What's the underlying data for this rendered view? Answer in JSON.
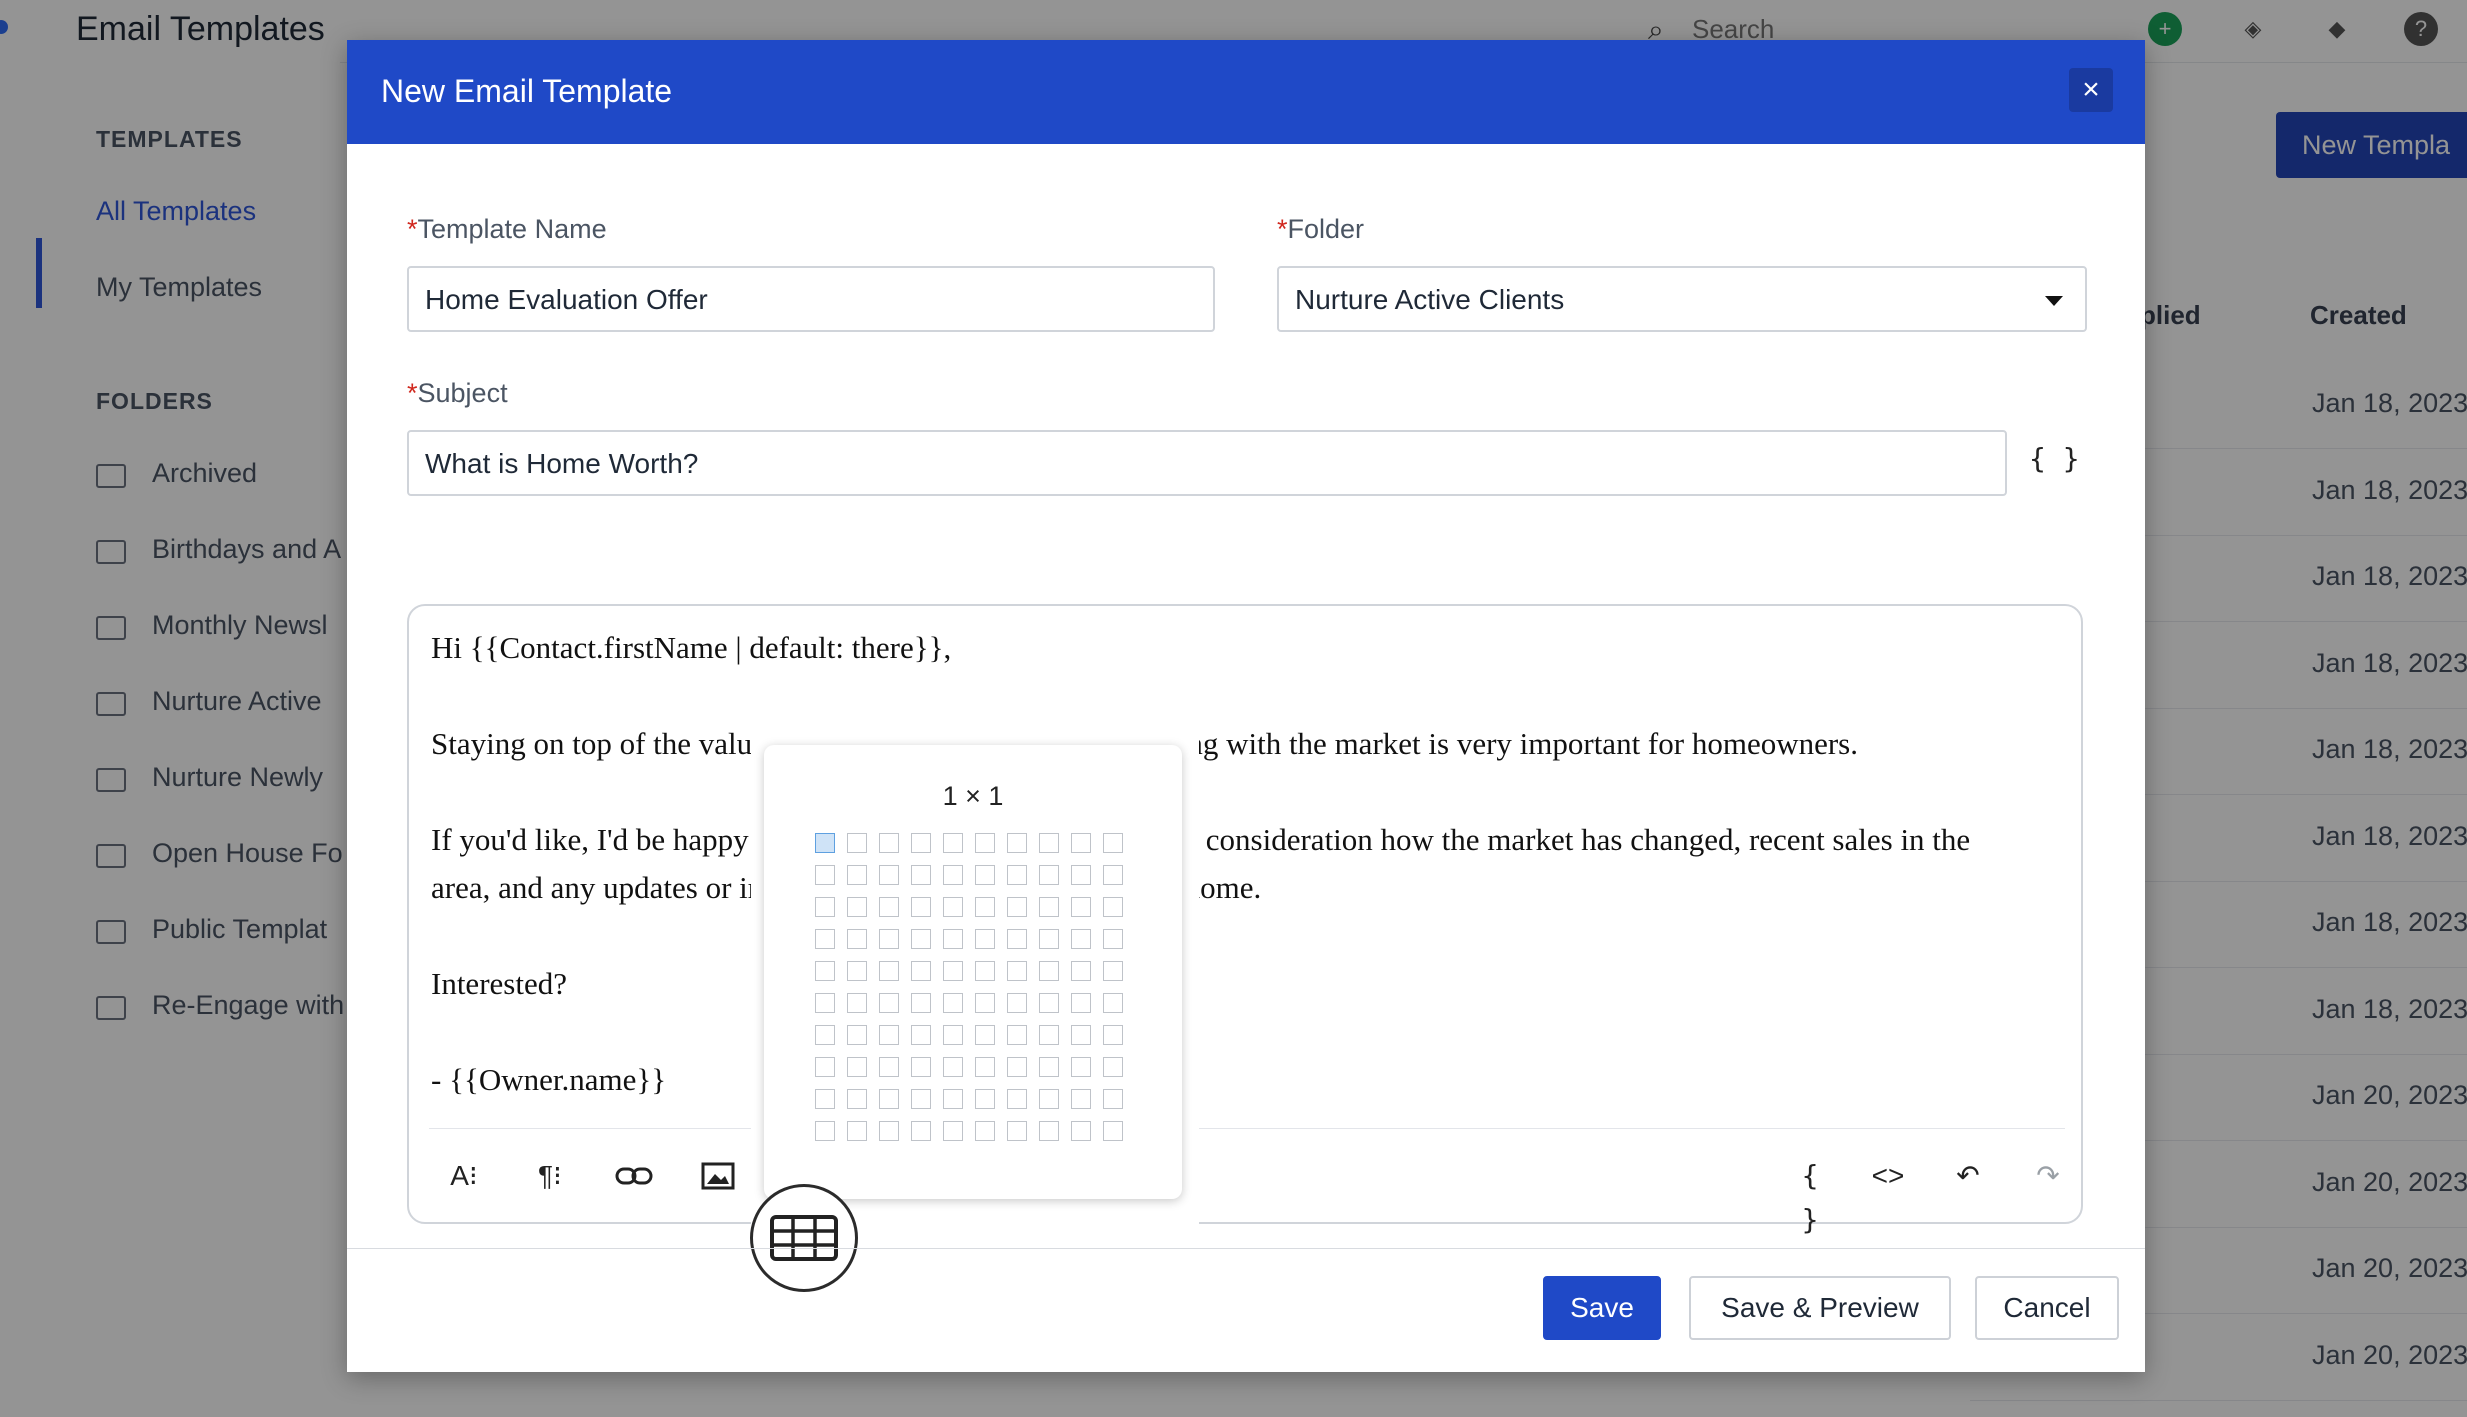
{
  "app": {
    "title": "Email Templates",
    "search_placeholder": "Search",
    "new_template_label": "New Templa"
  },
  "sidebar": {
    "templates_heading": "TEMPLATES",
    "templates_items": [
      {
        "label": "All Templates",
        "active": true
      },
      {
        "label": "My Templates",
        "active": false
      }
    ],
    "folders_heading": "FOLDERS",
    "folders": [
      {
        "label": "Archived"
      },
      {
        "label": "Birthdays and A"
      },
      {
        "label": "Monthly Newsl"
      },
      {
        "label": "Nurture Active"
      },
      {
        "label": "Nurture Newly"
      },
      {
        "label": "Open House Fo"
      },
      {
        "label": "Public Templat"
      },
      {
        "label": "Re-Engage with"
      }
    ]
  },
  "table": {
    "columns": [
      "plied",
      "Created"
    ],
    "dates": [
      "Jan 18, 2023",
      "Jan 18, 2023",
      "Jan 18, 2023",
      "Jan 18, 2023",
      "Jan 18, 2023",
      "Jan 18, 2023",
      "Jan 18, 2023",
      "Jan 18, 2023",
      "Jan 20, 2023",
      "Jan 20, 2023",
      "Jan 20, 2023",
      "Jan 20, 2023"
    ]
  },
  "modal": {
    "title": "New Email Template",
    "template_name_label": "Template Name",
    "template_name_value": "Home Evaluation Offer",
    "folder_label": "Folder",
    "folder_value": "Nurture Active Clients",
    "subject_label": "Subject",
    "subject_value": "What is Home Worth?",
    "required_mark": "*",
    "braces_symbol": "{ }",
    "body_lines": [
      "Hi {{Contact.firstName | default: there}},",
      "Staying on top of the value of your home and how it's changing with the market is very important for homeowners.",
      "If you'd like, I'd be happy to provide an evaluation taking into consideration how the market has changed, recent sales in the",
      "area, and any updates or improvements you've made to your home.",
      "Interested?",
      "- {{Owner.name}}"
    ],
    "buttons": {
      "save": "Save",
      "save_preview": "Save & Preview",
      "cancel": "Cancel"
    }
  },
  "table_picker": {
    "label": "1 × 1",
    "rows": 10,
    "cols": 10,
    "selected_rows": 1,
    "selected_cols": 1
  },
  "toolbar_icons": [
    "font-size-icon",
    "paragraph-icon",
    "link-icon",
    "image-icon",
    "table-icon",
    "calendar-icon",
    "merge-field-icon",
    "code-icon",
    "undo-icon",
    "redo-icon"
  ],
  "colors": {
    "brand_blue": "#1f49c7",
    "required_red": "#d0281e",
    "selected_cell": "#cfe3f7"
  }
}
